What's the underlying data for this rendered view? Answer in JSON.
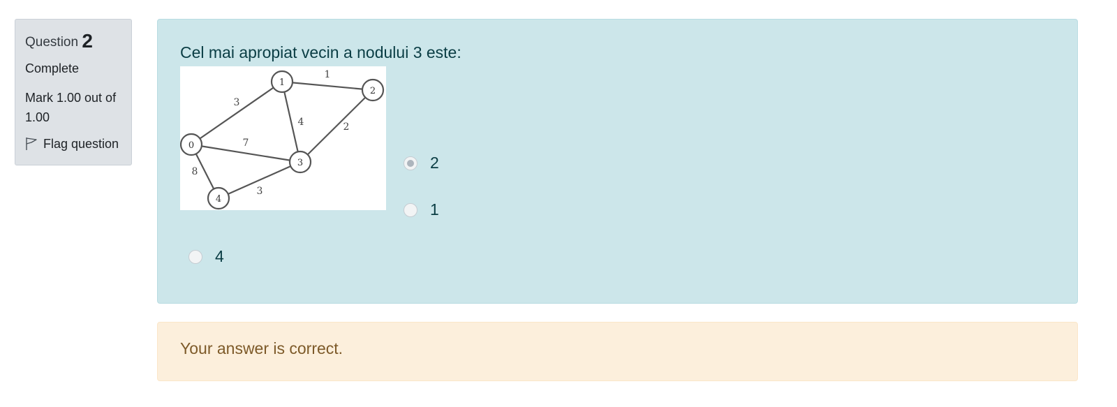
{
  "info": {
    "question_label": "Question",
    "question_number": "2",
    "state": "Complete",
    "grade": "Mark 1.00 out of 1.00",
    "flag_label": "Flag question"
  },
  "question": {
    "text": "Cel mai apropiat vecin a nodului 3 este:",
    "graph": {
      "nodes": [
        "0",
        "1",
        "2",
        "3",
        "4"
      ],
      "edges": [
        {
          "from": "0",
          "to": "1",
          "weight": "3"
        },
        {
          "from": "1",
          "to": "2",
          "weight": "1"
        },
        {
          "from": "1",
          "to": "3",
          "weight": "4"
        },
        {
          "from": "2",
          "to": "3",
          "weight": "2"
        },
        {
          "from": "0",
          "to": "3",
          "weight": "7"
        },
        {
          "from": "0",
          "to": "4",
          "weight": "8"
        },
        {
          "from": "4",
          "to": "3",
          "weight": "3"
        }
      ]
    },
    "options": [
      {
        "label": "2",
        "selected": true
      },
      {
        "label": "1",
        "selected": false
      },
      {
        "label": "4",
        "selected": false
      }
    ]
  },
  "feedback": {
    "message": "Your answer is correct."
  },
  "colors": {
    "info_bg": "#dee2e6",
    "question_bg": "#cce6ea",
    "feedback_bg": "#fcefdc",
    "feedback_text": "#7d5a29"
  }
}
